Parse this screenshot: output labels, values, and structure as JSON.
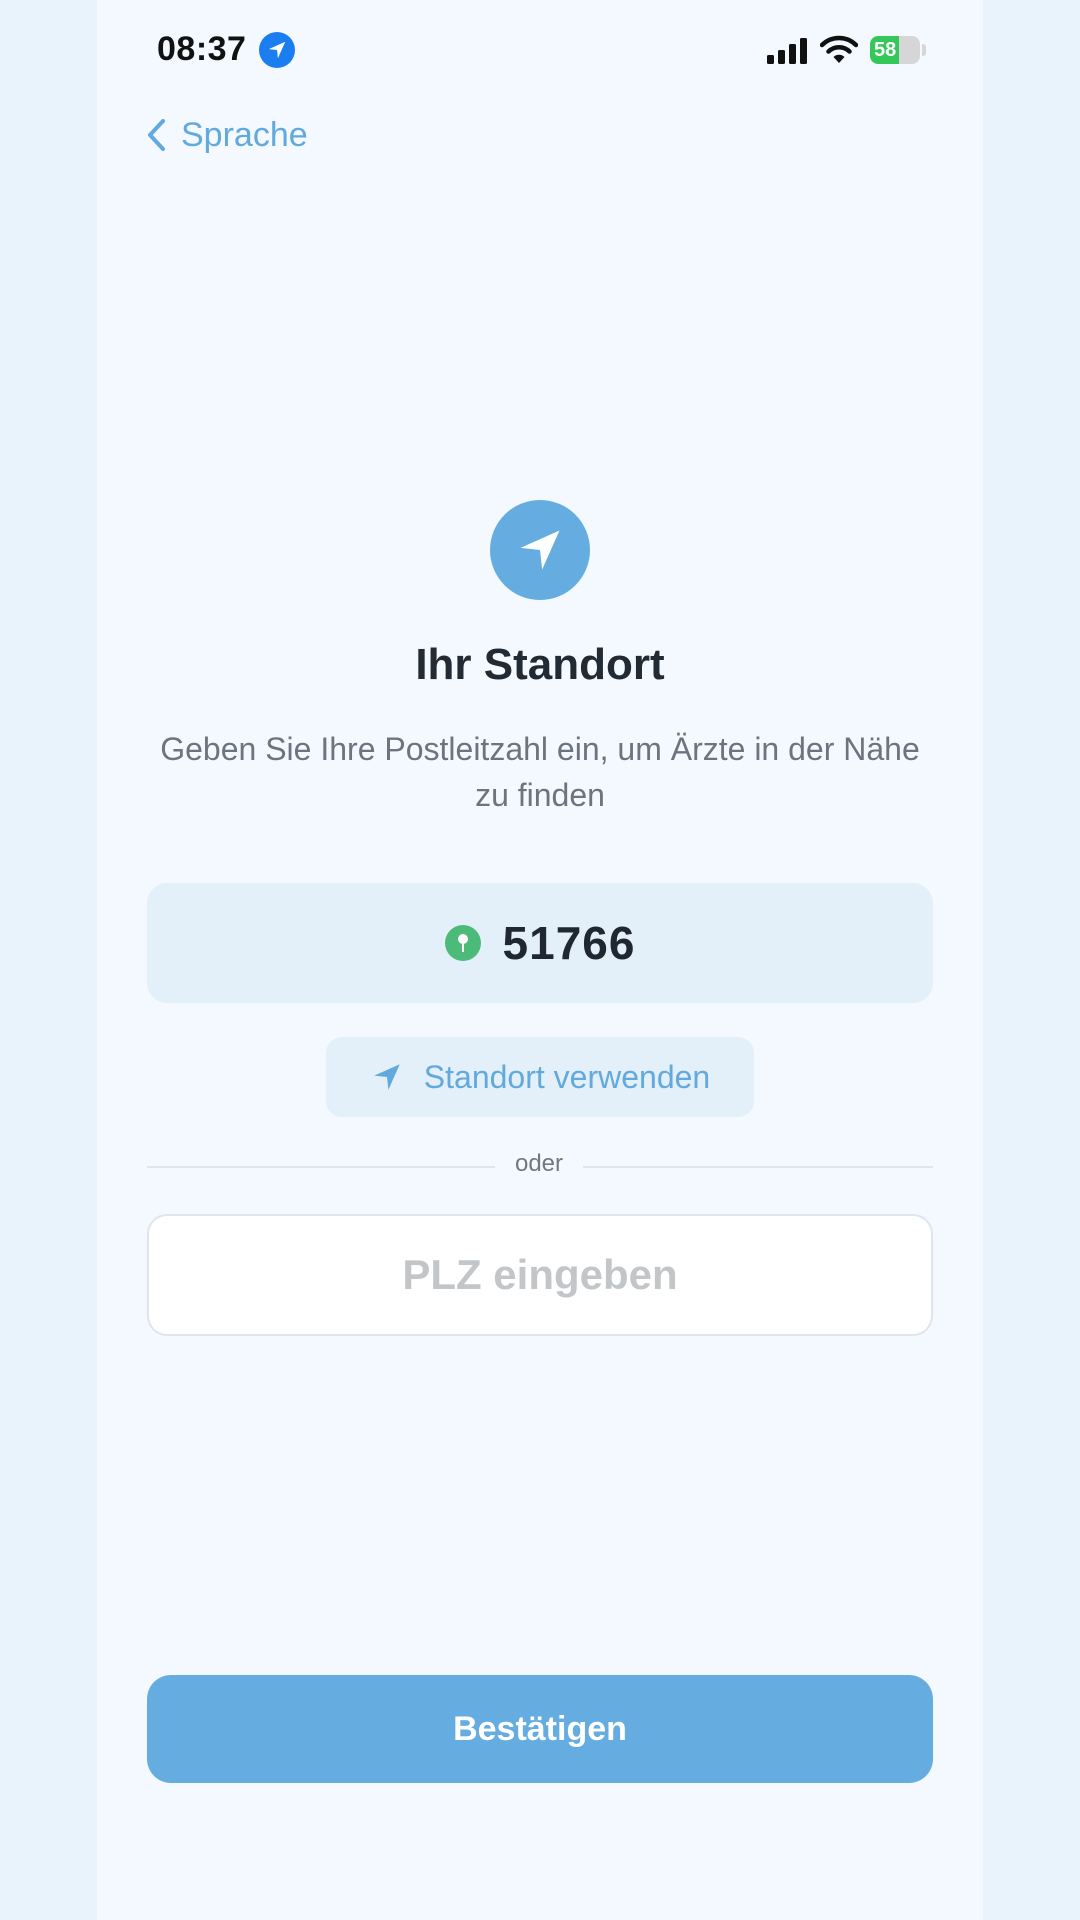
{
  "status_bar": {
    "time": "08:37",
    "battery_percent": "58",
    "battery_level": 0.58,
    "location_active_icon": "location-arrow-icon",
    "signal_icon": "cellular-signal-icon",
    "wifi_icon": "wifi-icon"
  },
  "nav": {
    "back_label": "Sprache",
    "back_icon": "chevron-left-icon"
  },
  "hero": {
    "icon": "location-arrow-icon",
    "title": "Ihr Standort",
    "subtitle": "Geben Sie Ihre Postleitzahl ein, um Ärzte in der Nähe zu finden"
  },
  "detected_location": {
    "icon": "map-pin-icon",
    "postal_code": "51766"
  },
  "use_location": {
    "icon": "location-arrow-icon",
    "label": "Standort verwenden"
  },
  "divider": {
    "label": "oder"
  },
  "postal_input": {
    "placeholder": "PLZ eingeben",
    "value": ""
  },
  "confirm": {
    "label": "Bestätigen"
  },
  "colors": {
    "accent": "#65ade1",
    "link": "#62a9dd",
    "card_background": "#e3eff9",
    "page_background": "#f3f9fe",
    "pin_green": "#4cbb7a",
    "battery_green": "#34c759"
  }
}
